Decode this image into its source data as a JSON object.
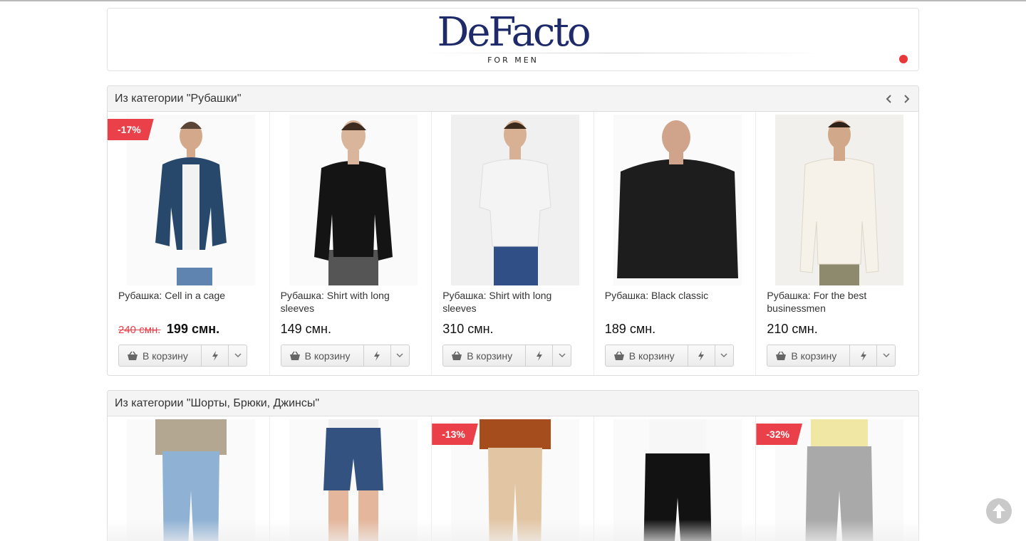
{
  "banner": {
    "brand": "DeFacto",
    "subtitle": "FOR MEN"
  },
  "sections": [
    {
      "title": "Из категории \"Рубашки\"",
      "products": [
        {
          "name": "Рубашка: Cell in a cage",
          "old_price": "240 смн.",
          "price": "199 смн.",
          "discount": "-17%"
        },
        {
          "name": "Рубашка: Shirt with long sleeves",
          "price": "149 смн."
        },
        {
          "name": "Рубашка: Shirt with long sleeves",
          "price": "310 смн."
        },
        {
          "name": "Рубашка: Black classic",
          "price": "189 смн."
        },
        {
          "name": "Рубашка: For the best businessmen",
          "price": "210 смн."
        }
      ]
    },
    {
      "title": "Из категории \"Шорты, Брюки, Джинсы\"",
      "products": [
        {},
        {},
        {
          "discount": "-13%"
        },
        {},
        {
          "discount": "-32%"
        }
      ]
    }
  ],
  "buttons": {
    "add_to_cart": "В корзину"
  },
  "icons": [
    "chevron-left-icon",
    "chevron-right-icon",
    "cart-icon",
    "lightning-icon",
    "chevron-down-icon",
    "arrow-up-icon"
  ],
  "colors": {
    "brand": "#1f2a6b",
    "sale": "#e94049"
  }
}
